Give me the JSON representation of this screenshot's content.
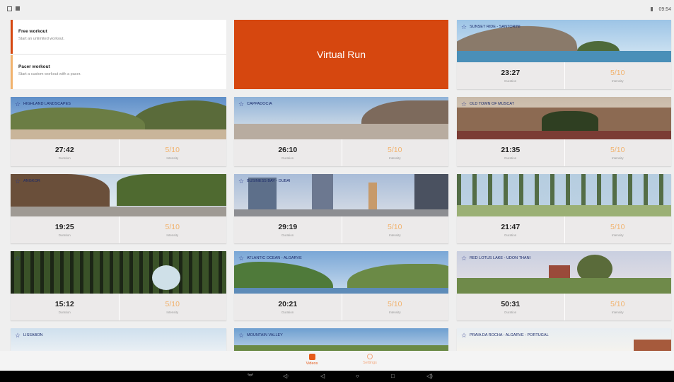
{
  "status_bar": {
    "time": "09:54",
    "battery_icon": "battery-icon"
  },
  "menu": [
    {
      "title": "Free workout",
      "subtitle": "Start an unlimited workout.",
      "accent": "#d6470f"
    },
    {
      "title": "Pacer workout",
      "subtitle": "Start a custom workout with a pacer.",
      "accent": "#f1b26d"
    }
  ],
  "hero": {
    "label": "Virtual Run",
    "color": "#d6470f"
  },
  "stat_labels": {
    "duration": "Duration",
    "intensity": "Intensity"
  },
  "routes": [
    {
      "name": "SUNSET RIDE - SANTORINI",
      "duration": "23:27",
      "intensity": "5/10"
    },
    {
      "name": "HIGHLAND LANDSCAPES",
      "duration": "27:42",
      "intensity": "5/10"
    },
    {
      "name": "CAPPADOCIA",
      "duration": "26:10",
      "intensity": "5/10"
    },
    {
      "name": "OLD TOWN OF MUSCAT",
      "duration": "21:35",
      "intensity": "5/10"
    },
    {
      "name": "ANGKOR",
      "duration": "19:25",
      "intensity": "5/10"
    },
    {
      "name": "BUSINESS BAY - DUBAI",
      "duration": "29:19",
      "intensity": "5/10"
    },
    {
      "name": "",
      "duration": "21:47",
      "intensity": "5/10"
    },
    {
      "name": "",
      "duration": "15:12",
      "intensity": "5/10"
    },
    {
      "name": "ATLANTIC OCEAN - ALGARVE",
      "duration": "20:21",
      "intensity": "5/10"
    },
    {
      "name": "RED LOTUS LAKE - UDON THANI",
      "duration": "50:31",
      "intensity": "5/10"
    },
    {
      "name": "LISSABON",
      "duration": "",
      "intensity": ""
    },
    {
      "name": "MOUNTAIN VALLEY",
      "duration": "",
      "intensity": ""
    },
    {
      "name": "PRAIA DA ROCHA - ALGARVE - PORTUGAL",
      "duration": "",
      "intensity": ""
    }
  ],
  "bottom_nav": [
    {
      "label": "Videos",
      "icon": "video-icon",
      "active": true
    },
    {
      "label": "Settings",
      "icon": "gear-icon",
      "active": false
    }
  ],
  "colors": {
    "accent": "#d6470f",
    "intensity": "#f1b26d",
    "active_tab": "#e65a1a"
  }
}
